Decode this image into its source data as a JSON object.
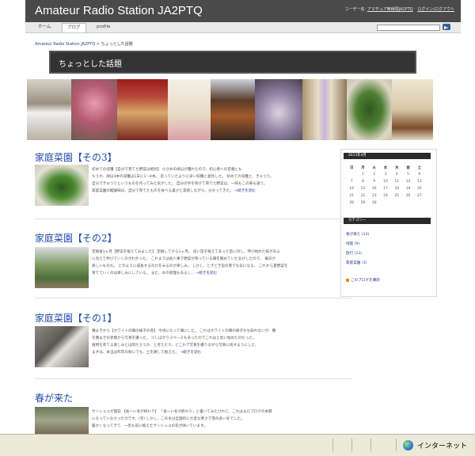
{
  "header": {
    "site_title": "Amateur Radio Station JA2PTQ",
    "user_prefix": "ユーザー名:",
    "user_name": "アマチュア無線局JA2PTQ",
    "logout": "ログイン/ログアウト"
  },
  "nav": {
    "tabs": [
      "ホーム",
      "ブログ",
      "profile"
    ],
    "active_tab": "ブログ"
  },
  "breadcrumb": {
    "home": "Amateur Radio Station JA2PTQ",
    "sep": " > ",
    "current": "ちょっとした話題"
  },
  "banner": {
    "title": "ちょっとした話題"
  },
  "colors": {
    "header_bg": "#4a4a4a",
    "banner_bg": "#333333",
    "post_title": "#1e4aa8",
    "link": "#2a3d8f",
    "statusbar_bg": "#ece9d8"
  },
  "photo_strip": [
    {
      "name": "robot-photo",
      "color": "#8d7f6d"
    },
    {
      "name": "plum-blossom-photo",
      "color": "#c9798a"
    },
    {
      "name": "hina-doll-photo",
      "color": "#8a3a34"
    },
    {
      "name": "book-cover-photo",
      "color": "#f3ece1"
    },
    {
      "name": "float-festival-photo",
      "color": "#6b4a3a"
    },
    {
      "name": "still-life-photo",
      "color": "#9a8aa8"
    },
    {
      "name": "flower-scroll-photo",
      "color": "#b8a58a"
    },
    {
      "name": "cucumber-photo",
      "color": "#3f6b2e"
    },
    {
      "name": "biwa-poster-photo",
      "color": "#d9cfb8"
    }
  ],
  "posts": [
    {
      "title": "家庭菜園【その3】",
      "thumb": "cucumbers-thumbnail",
      "body": [
        "初めての収穫【自分で育てた野菜は格別】 小さめの胡瓜が穫れたので、初心者への定番とも",
        "ちうか、胡瓜4本の収穫は1日に1〜4本。 思っていたよりに早い収穫と発見した。 初めての収穫と、きゅうり。",
        "自分できゅうりというものを作ってみた気がした。 自分の手を掛けて育てた野菜は、一味もこの味も違う。",
        "家庭菜園の醍醐味は、自分で育てたものを食べる喜びと実感しながら、分かってきた。"
      ],
      "more": "→続きを読む"
    },
    {
      "title": "家庭菜園【その2】",
      "thumb": "garden-thumbnail",
      "body": [
        "定植後1ヶ月【野菜を植えてみました】 定植してから1ヶ月。 低い苗を植えてあった苗に対し、伸び始めた枝がある",
        "に見えて伸びていくのがわかった。 これまでは他人事で野菜が育っている畑を眺めていた気がしたので、 毎日が",
        "楽しいものだ。 どのように成長するのかをみるのが楽しみ。 しかし、ときどき虫の害でも気になる。 これから夏野菜を",
        "育てていくのは楽しみにしている。 また、水の管理もあるし…"
      ],
      "more": "→続きを読む"
    },
    {
      "title": "家庭菜園【その1】",
      "thumb": "seedbed-thumbnail",
      "body": [
        "種まきから【ホワイトの畑の様子の巻】 今頃になって畑にした。 これはホワイトの畑の様子かも知れないが、種",
        "を種まきの状態から写真を撮った。 少しばかりスペースもあったのでこれはと思い始めたのだった。",
        "植物を育てる楽しみとは何だろうか、と考えたり、どこかで写真を撮りながら写真に残すようにした、",
        "まずは、本当は昨年の秋にでも、土を耕して植えた。"
      ],
      "more": "→続きを読む"
    },
    {
      "title": "春が来た",
      "thumb": "spring-thumbnail",
      "body": [
        "サンシュユが開花 【長〜い冬が終わり】 「長〜い冬が終わり」と書いてみたけれど、これはまだブログの本題",
        "になっていなかったのです。(笑) しかし、この冬は全国的に大変な寒さで雪の多い冬でした。",
        "暖かくなってきて、一年も前に植えたサンシュユの花が咲いています。"
      ],
      "more": ""
    }
  ],
  "sidebar": {
    "calendar_title": "2013年4月",
    "weekdays": [
      "日",
      "月",
      "火",
      "水",
      "木",
      "金",
      "土"
    ],
    "weeks": [
      [
        "",
        "1",
        "2",
        "3",
        "4",
        "5",
        "6"
      ],
      [
        "7",
        "8",
        "9",
        "10",
        "11",
        "12",
        "13"
      ],
      [
        "14",
        "15",
        "16",
        "17",
        "18",
        "19",
        "20"
      ],
      [
        "21",
        "22",
        "23",
        "24",
        "25",
        "26",
        "27"
      ],
      [
        "28",
        "29",
        "30",
        "",
        "",
        "",
        ""
      ]
    ],
    "categories_title": "カテゴリー",
    "categories": [
      "春が来た (14)",
      "地震 (9)",
      "旅行 (13)",
      "家庭菜園 (3)"
    ],
    "feed": "このブログを購読"
  },
  "statusbar": {
    "zone": "インターネット"
  }
}
